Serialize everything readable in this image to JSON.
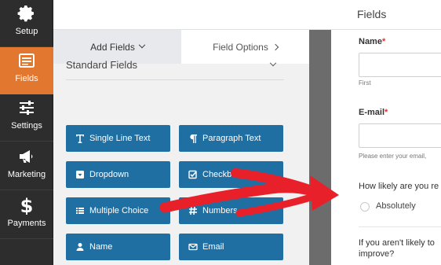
{
  "sidebar": {
    "items": [
      {
        "label": "Setup",
        "icon": "gear-icon"
      },
      {
        "label": "Fields",
        "icon": "list-icon"
      },
      {
        "label": "Settings",
        "icon": "sliders-icon"
      },
      {
        "label": "Marketing",
        "icon": "megaphone-icon"
      },
      {
        "label": "Payments",
        "icon": "dollar-icon"
      }
    ],
    "active": "Fields",
    "accent": "#e27730"
  },
  "header": {
    "title": "Fields"
  },
  "tabs": {
    "add_fields": "Add Fields",
    "field_options": "Field Options"
  },
  "section": {
    "title": "Standard Fields"
  },
  "field_buttons": [
    "Single Line Text",
    "Paragraph Text",
    "Dropdown",
    "Checkboxes",
    "Multiple Choice",
    "Numbers",
    "Name",
    "Email"
  ],
  "colors": {
    "field_button": "#1f6fa3",
    "arrow": "#e8202a"
  },
  "preview": {
    "name_label": "Name",
    "name_required": "*",
    "name_sub": "First",
    "email_label": "E-mail",
    "email_required": "*",
    "email_sub": "Please enter your email,",
    "question": "How likely are you re",
    "option": "Absolutely",
    "question2_line1": "If you aren't likely to",
    "question2_line2": "improve?"
  }
}
